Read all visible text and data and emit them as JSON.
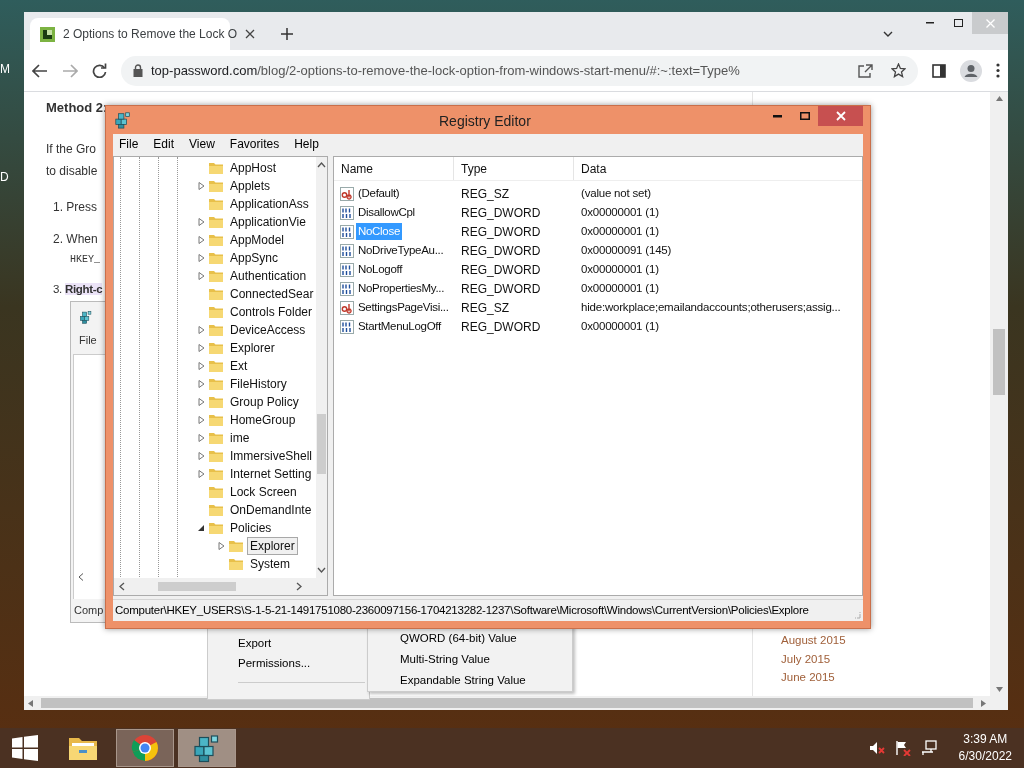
{
  "desktop": {
    "labels": [
      "M",
      "D"
    ]
  },
  "browser": {
    "tab": {
      "title": "2 Options to Remove the Lock O",
      "selected": true
    },
    "address": "top-password.com/blog/2-options-to-remove-the-lock-option-from-windows-start-menu/#:~:text=Type%",
    "article": [
      {
        "kind": "heading",
        "text": "Method 2:"
      },
      {
        "kind": "text",
        "text": "If the Gro"
      },
      {
        "kind": "text",
        "text": "to disable"
      },
      {
        "kind": "step",
        "text": "1. Press"
      },
      {
        "kind": "step",
        "text": "2. When"
      },
      {
        "kind": "code",
        "text": "HKEY_"
      },
      {
        "kind": "highlight",
        "text": "3. Right-c"
      }
    ],
    "figure": {
      "menu": "File",
      "status": "Comp"
    },
    "context_menu": [
      "Export",
      "Permissions..."
    ],
    "submenu": [
      "QWORD (64-bit) Value",
      "Multi-String Value",
      "Expandable String Value"
    ],
    "archive": [
      "August 2015",
      "July 2015",
      "June 2015"
    ]
  },
  "regedit": {
    "title": "Registry Editor",
    "menu": [
      "File",
      "Edit",
      "View",
      "Favorites",
      "Help"
    ],
    "tree": [
      {
        "name": "AppHost",
        "selected": false
      },
      {
        "name": "Applets",
        "expanded": false,
        "selected": false
      },
      {
        "name": "ApplicationAss",
        "selected": false
      },
      {
        "name": "ApplicationVie",
        "expanded": false,
        "selected": false
      },
      {
        "name": "AppModel",
        "expanded": false,
        "selected": false
      },
      {
        "name": "AppSync",
        "expanded": false,
        "selected": false
      },
      {
        "name": "Authentication",
        "expanded": false,
        "selected": false
      },
      {
        "name": "ConnectedSear",
        "selected": false
      },
      {
        "name": "Controls Folder",
        "selected": false
      },
      {
        "name": "DeviceAccess",
        "expanded": false,
        "selected": false
      },
      {
        "name": "Explorer",
        "expanded": false,
        "selected": false
      },
      {
        "name": "Ext",
        "expanded": false,
        "selected": false
      },
      {
        "name": "FileHistory",
        "expanded": false,
        "selected": false
      },
      {
        "name": "Group Policy",
        "expanded": false,
        "selected": false
      },
      {
        "name": "HomeGroup",
        "expanded": false,
        "selected": false
      },
      {
        "name": "ime",
        "expanded": false,
        "selected": false
      },
      {
        "name": "ImmersiveShell",
        "expanded": false,
        "selected": false
      },
      {
        "name": "Internet Setting",
        "expanded": false,
        "selected": false
      },
      {
        "name": "Lock Screen",
        "selected": false
      },
      {
        "name": "OnDemandInte",
        "selected": false
      },
      {
        "name": "Policies",
        "expanded": true,
        "selected": false,
        "children": [
          {
            "name": "Explorer",
            "expanded": false,
            "selected": true
          },
          {
            "name": "System",
            "selected": false
          }
        ]
      }
    ],
    "columns": [
      "Name",
      "Type",
      "Data"
    ],
    "rows": [
      {
        "kind": "string",
        "name": "(Default)",
        "type": "REG_SZ",
        "data": "(value not set)",
        "selected": false
      },
      {
        "kind": "dword",
        "name": "DisallowCpl",
        "type": "REG_DWORD",
        "data": "0x00000001 (1)",
        "selected": false
      },
      {
        "kind": "dword",
        "name": "NoClose",
        "type": "REG_DWORD",
        "data": "0x00000001 (1)",
        "selected": true
      },
      {
        "kind": "dword",
        "name": "NoDriveTypeAu...",
        "type": "REG_DWORD",
        "data": "0x00000091 (145)",
        "selected": false
      },
      {
        "kind": "dword",
        "name": "NoLogoff",
        "type": "REG_DWORD",
        "data": "0x00000001 (1)",
        "selected": false
      },
      {
        "kind": "dword",
        "name": "NoPropertiesMy...",
        "type": "REG_DWORD",
        "data": "0x00000001 (1)",
        "selected": false
      },
      {
        "kind": "string",
        "name": "SettingsPageVisi...",
        "type": "REG_SZ",
        "data": "hide:workplace;emailandaccounts;otherusers;assig...",
        "selected": false
      },
      {
        "kind": "dword",
        "name": "StartMenuLogOff",
        "type": "REG_DWORD",
        "data": "0x00000001 (1)",
        "selected": false
      }
    ],
    "status": "Computer\\HKEY_USERS\\S-1-5-21-1491751080-2360097156-1704213282-1237\\Software\\Microsoft\\Windows\\CurrentVersion\\Policies\\Explore"
  },
  "taskbar": {
    "apps": [
      {
        "kind": "folder",
        "running": false,
        "selected": false
      },
      {
        "kind": "chrome",
        "running": true,
        "selected": false
      },
      {
        "kind": "registry",
        "running": true,
        "selected": true
      }
    ],
    "time": "3:39 AM",
    "date": "6/30/2022"
  }
}
